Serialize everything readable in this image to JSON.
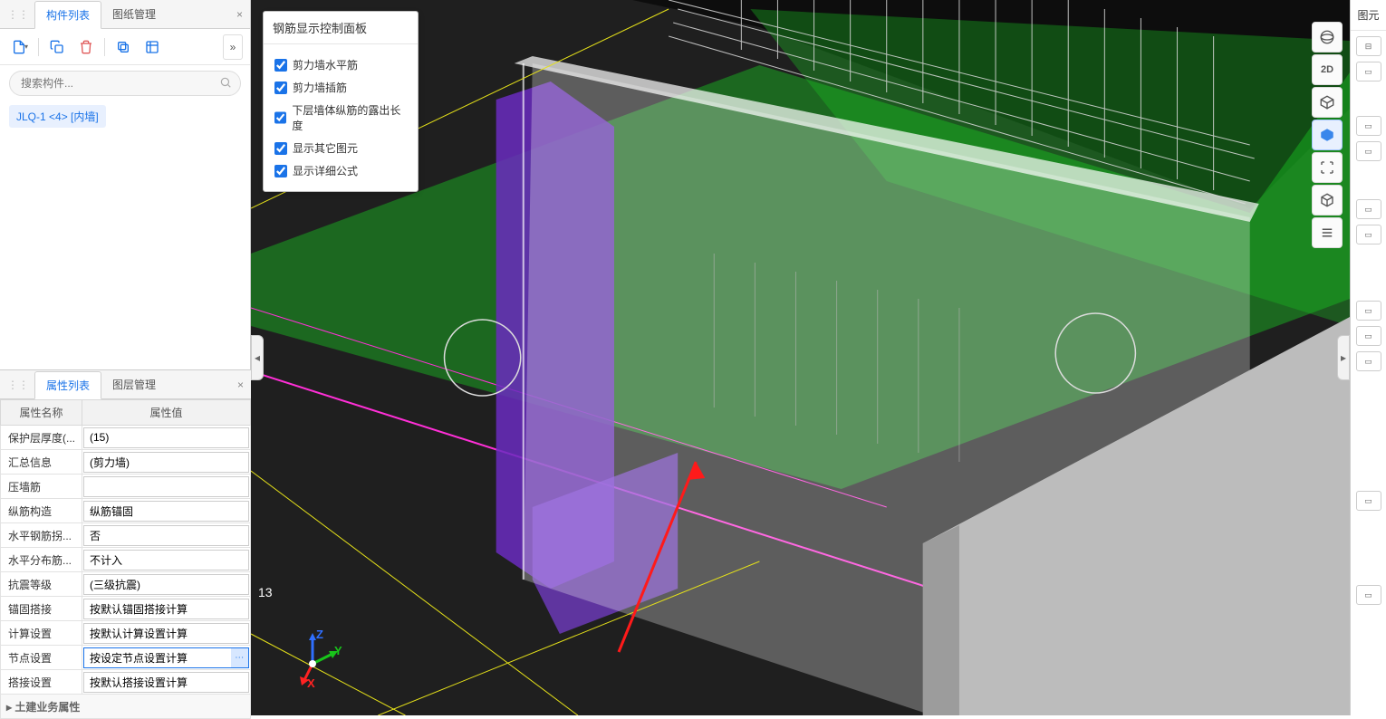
{
  "left": {
    "tabs": {
      "components": "构件列表",
      "drawings": "图纸管理"
    },
    "searchPlaceholder": "搜索构件...",
    "listItem": "JLQ-1 <4> [内墙]",
    "more": "»"
  },
  "props": {
    "tabs": {
      "attrs": "属性列表",
      "layers": "图层管理"
    },
    "headerName": "属性名称",
    "headerValue": "属性值",
    "rows": [
      {
        "k": "保护层厚度(...",
        "v": "(15)"
      },
      {
        "k": "汇总信息",
        "v": "(剪力墙)"
      },
      {
        "k": "压墙筋",
        "v": ""
      },
      {
        "k": "纵筋构造",
        "v": "纵筋锚固"
      },
      {
        "k": "水平钢筋拐...",
        "v": "否"
      },
      {
        "k": "水平分布筋...",
        "v": "不计入"
      },
      {
        "k": "抗震等级",
        "v": "(三级抗震)"
      },
      {
        "k": "锚固搭接",
        "v": "按默认锚固搭接计算"
      },
      {
        "k": "计算设置",
        "v": "按默认计算设置计算"
      },
      {
        "k": "节点设置",
        "v": "按设定节点设置计算",
        "sel": true
      },
      {
        "k": "搭接设置",
        "v": "按默认搭接设置计算"
      }
    ],
    "catRow": "▸ 土建业务属性"
  },
  "floatPanel": {
    "title": "钢筋显示控制面板",
    "options": [
      {
        "label": "剪力墙水平筋",
        "checked": true
      },
      {
        "label": "剪力墙插筋",
        "checked": true
      },
      {
        "label": "下层墙体纵筋的露出长度",
        "checked": true
      },
      {
        "label": "显示其它图元",
        "checked": true
      },
      {
        "label": "显示详细公式",
        "checked": true
      }
    ]
  },
  "viewTools": {
    "items": [
      {
        "name": "sphere-icon"
      },
      {
        "name": "2d-icon",
        "label": "2D"
      },
      {
        "name": "cube-wire-icon"
      },
      {
        "name": "cube-solid-icon",
        "active": true
      },
      {
        "name": "focus-icon"
      },
      {
        "name": "package-icon"
      },
      {
        "name": "list-icon"
      }
    ]
  },
  "rightStrip": {
    "tabLabel": "图元"
  },
  "viewport": {
    "annotation": "13",
    "axes": {
      "x": "X",
      "y": "Y",
      "z": "Z"
    }
  }
}
